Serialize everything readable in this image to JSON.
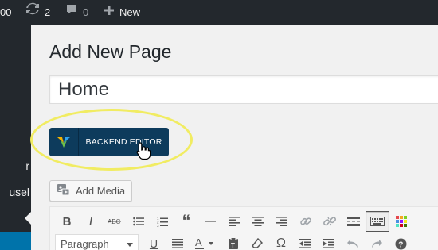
{
  "admin_bar": {
    "cut_count": "00",
    "updates_count": "2",
    "comments_count": "0",
    "new_label": "New"
  },
  "sidebar": {
    "items": [
      {
        "label": "r"
      },
      {
        "label": "usel"
      }
    ]
  },
  "page": {
    "title": "Add New Page",
    "title_input_value": "Home"
  },
  "backend_editor": {
    "label": "BACKEND EDITOR",
    "logo_icon": "visual-composer-logo"
  },
  "add_media": {
    "label": "Add Media"
  },
  "editor": {
    "format_select_value": "Paragraph",
    "toolbar_row1": [
      "bold",
      "italic",
      "strikethrough",
      "bulleted-list",
      "numbered-list",
      "blockquote",
      "horizontal-line",
      "align-left",
      "align-center",
      "align-right",
      "insert-link",
      "remove-link",
      "read-more",
      "toolbar-toggle",
      "color"
    ],
    "toolbar_row2": [
      "underline",
      "justify",
      "text-color",
      "paste-as-text",
      "clear-formatting",
      "special-character",
      "outdent",
      "indent",
      "undo",
      "redo",
      "help"
    ]
  },
  "colors": {
    "admin_bar": "#23282d",
    "vc_button": "#0d3b5c",
    "highlight": "#f1ec62",
    "current_menu": "#0073aa"
  }
}
